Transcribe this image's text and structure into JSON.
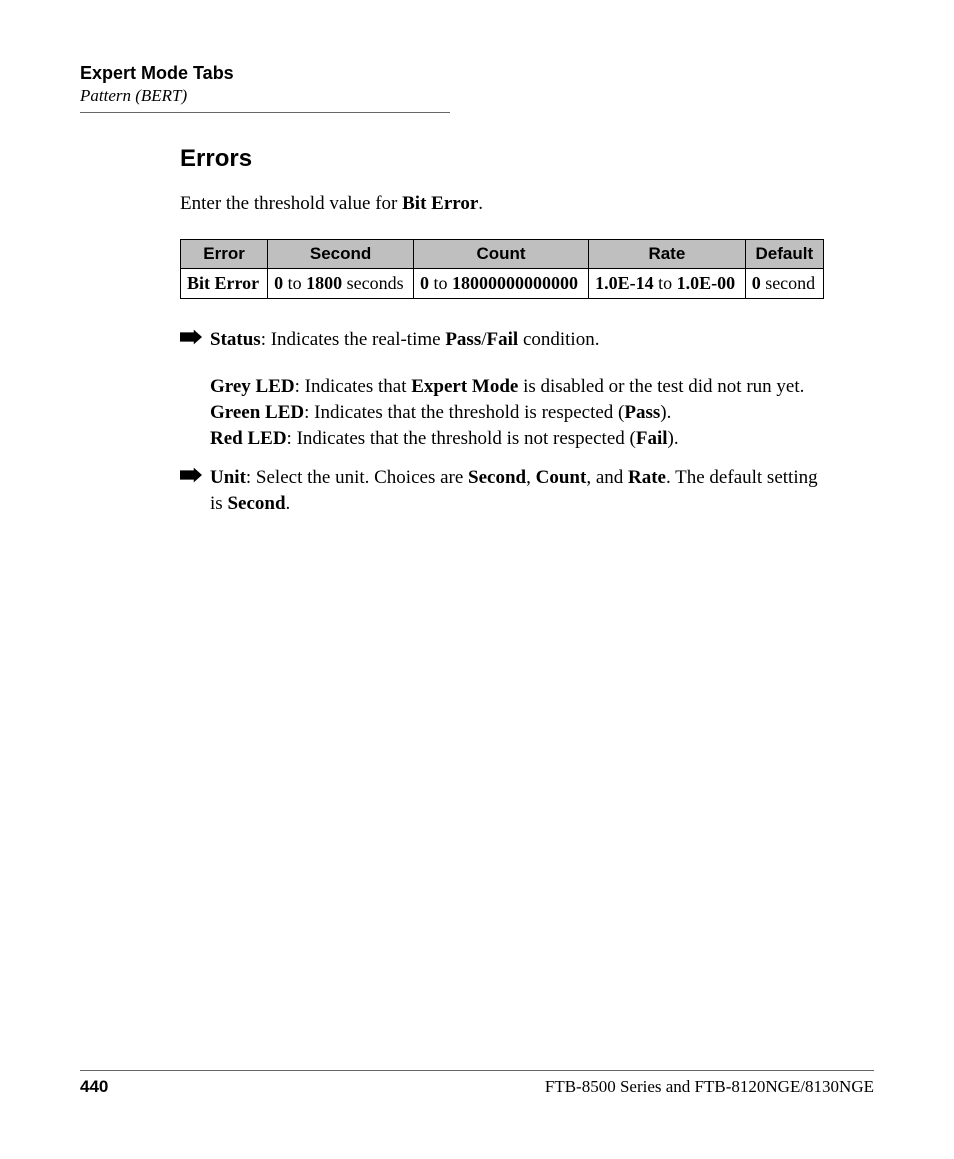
{
  "header": {
    "title": "Expert Mode Tabs",
    "subtitle": "Pattern (BERT)"
  },
  "section": {
    "title": "Errors",
    "intro_pre": "Enter the threshold value for ",
    "intro_bold": "Bit Error",
    "intro_post": "."
  },
  "table": {
    "headers": [
      "Error",
      "Second",
      "Count",
      "Rate",
      "Default"
    ],
    "row": {
      "error": "Bit Error",
      "second_b1": "0",
      "second_mid": " to ",
      "second_b2": "1800",
      "second_post": " seconds",
      "count_b1": "0",
      "count_mid": " to ",
      "count_b2": "18000000000000",
      "rate_b1": "1.0E-14",
      "rate_mid": " to ",
      "rate_b2": "1.0E-00",
      "default_b": "0",
      "default_post": " second"
    }
  },
  "bullets": {
    "status": {
      "label": "Status",
      "text1": ": Indicates the real-time ",
      "pass": "Pass",
      "slash": "/",
      "fail": "Fail",
      "text2": " condition."
    },
    "grey": {
      "label": "Grey LED",
      "text1": ": Indicates that ",
      "expert": "Expert Mode",
      "text2": " is disabled or the test did not run yet."
    },
    "green": {
      "label": "Green LED",
      "text1": ": Indicates that the threshold is respected (",
      "pass": "Pass",
      "text2": ")."
    },
    "red": {
      "label": "Red LED",
      "text1": ": Indicates that the threshold is not respected (",
      "fail": "Fail",
      "text2": ")."
    },
    "unit": {
      "label": "Unit",
      "text1": ": Select the unit. Choices are ",
      "c1": "Second",
      "comma1": ", ",
      "c2": "Count",
      "comma2": ", and ",
      "c3": "Rate",
      "text2": ". The default setting is ",
      "def": "Second",
      "text3": "."
    }
  },
  "footer": {
    "page": "440",
    "doc": "FTB-8500 Series and FTB-8120NGE/8130NGE"
  }
}
